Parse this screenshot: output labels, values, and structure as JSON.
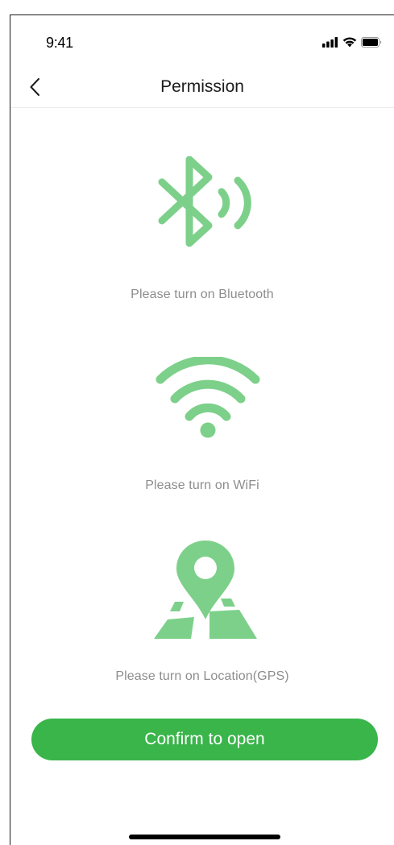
{
  "status_bar": {
    "time": "9:41"
  },
  "nav": {
    "title": "Permission"
  },
  "permissions": [
    {
      "icon": "bluetooth-icon",
      "label": "Please turn on Bluetooth"
    },
    {
      "icon": "wifi-icon",
      "label": "Please turn on WiFi"
    },
    {
      "icon": "location-map-icon",
      "label": "Please turn on Location(GPS)"
    }
  ],
  "actions": {
    "confirm_label": "Confirm to open"
  },
  "colors": {
    "icon_green": "#7dd08a",
    "button_green": "#39b54a",
    "hint_gray": "#8d8d8d"
  }
}
